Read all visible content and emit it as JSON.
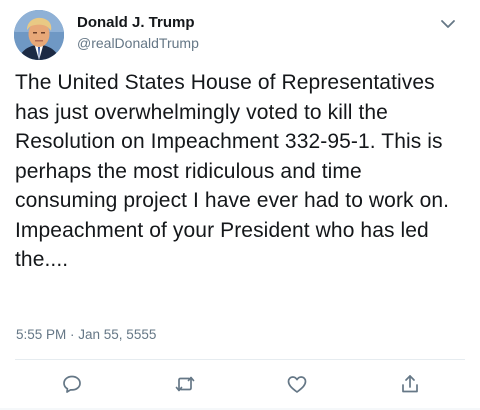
{
  "tweet": {
    "author": {
      "display_name": "Donald J. Trump",
      "handle": "@realDonaldTrump",
      "avatar_icon": "profile-photo"
    },
    "text": "The United States House of Representatives has just overwhelmingly voted to kill the Resolution on Impeachment 332-95-1. This is perhaps the most ridiculous and time consuming project I have ever had to work on. Impeachment of your President who has led the....",
    "timestamp": "5:55 PM · Jan 55, 5555"
  },
  "actions": [
    {
      "name": "reply",
      "icon": "speech-bubble-icon"
    },
    {
      "name": "retweet",
      "icon": "retweet-arrows-icon"
    },
    {
      "name": "like",
      "icon": "heart-icon"
    },
    {
      "name": "share",
      "icon": "upload-share-icon"
    }
  ],
  "colors": {
    "text_primary": "#14171a",
    "text_secondary": "#657786",
    "divider": "#e6ecf0"
  }
}
